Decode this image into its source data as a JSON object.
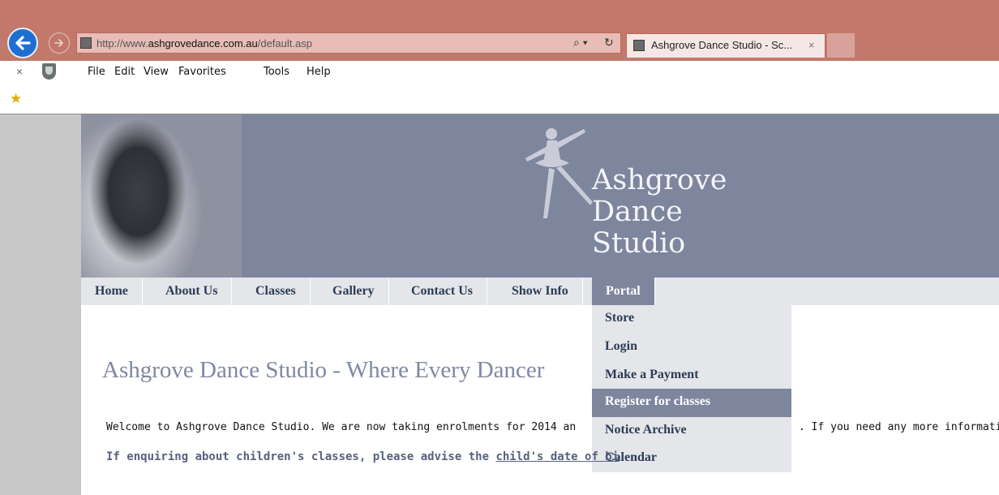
{
  "browser": {
    "url_prefix": "http://www.",
    "url_domain": "ashgrovedance.com.au",
    "url_path": "/default.asp",
    "search_glyph": "⌕ ▾",
    "refresh_glyph": "↻",
    "tab_title": "Ashgrove Dance Studio - Sc...",
    "tab_close": "×",
    "close_glyph": "×",
    "menu": [
      "File",
      "Edit",
      "View",
      "Favorites",
      "Tools",
      "Help"
    ],
    "icons": {
      "back": "back-arrow-icon",
      "forward": "forward-arrow-icon",
      "favorites": "add-favorite-star-icon",
      "shield": "shield-icon"
    },
    "colors": {
      "chrome": "#c2786a",
      "back_button": "#1f6fd2"
    }
  },
  "site": {
    "logo_line1": "Ashgrove",
    "logo_line2": "Dance",
    "logo_line3": "Studio",
    "nav": [
      "Home",
      "About Us",
      "Classes",
      "Gallery",
      "Contact Us",
      "Show Info",
      "Portal"
    ],
    "active_nav": "Portal",
    "dropdown": [
      "Store",
      "Login",
      "Make a Payment",
      "Register for classes",
      "Notice Archive",
      "Calendar"
    ],
    "hovered_dropdown": "Register for classes",
    "headline": "Ashgrove Dance Studio - Where Every Dancer",
    "welcome_visible_start": "Welcome to Ashgrove Dance Studio. We are now taking enrolments for 2014 an",
    "welcome_visible_end": ". If you need any more information",
    "enquire_start": "If enquiring about children's classes, please advise the ",
    "enquire_link": "child's date of bi",
    "colors": {
      "banner": "#7e869e",
      "nav_bg": "#e5e6ea",
      "nav_text": "#2b3c55",
      "headline": "#7f88a2"
    }
  }
}
